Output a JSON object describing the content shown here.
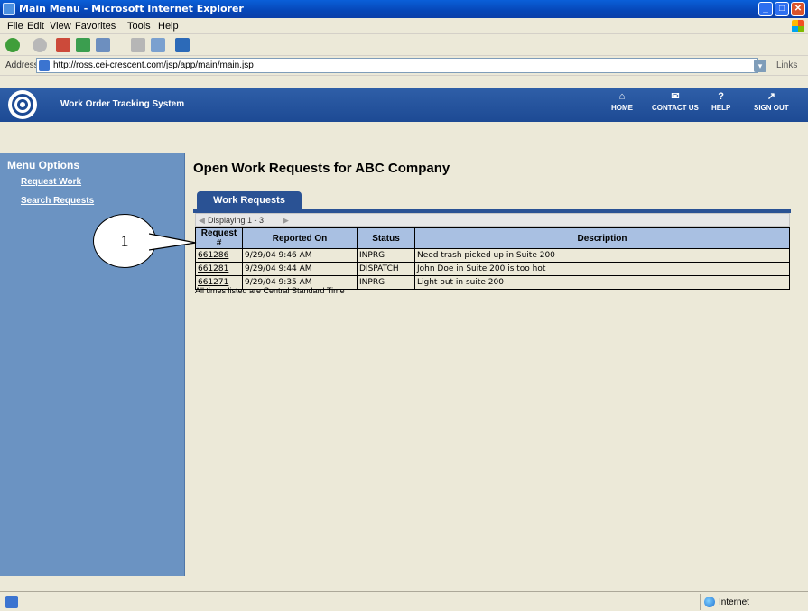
{
  "window": {
    "title": "Main Menu - Microsoft Internet Explorer"
  },
  "menubar": {
    "items": [
      "File",
      "Edit",
      "View",
      "Favorites",
      "Tools",
      "Help"
    ]
  },
  "address": {
    "label": "Address",
    "url": "http://ross.cei-crescent.com/jsp/app/main/main.jsp",
    "links_label": "Links"
  },
  "header": {
    "app_title": "Work Order Tracking System",
    "nav": {
      "home": "HOME",
      "contact": "CONTACT US",
      "help": "HELP",
      "signout": "SIGN OUT"
    }
  },
  "sidebar": {
    "heading": "Menu Options",
    "items": [
      "Request Work",
      "Search Requests"
    ]
  },
  "main": {
    "title": "Open Work Requests for ABC Company",
    "tab_label": "Work Requests",
    "paging": "Displaying 1 - 3",
    "columns": [
      "Request #",
      "Reported On",
      "Status",
      "Description"
    ],
    "rows": [
      {
        "request": "661286",
        "reported": "9/29/04 9:46 AM",
        "status": "INPRG",
        "description": "Need trash picked up in Suite 200"
      },
      {
        "request": "661281",
        "reported": "9/29/04 9:44 AM",
        "status": "DISPATCH",
        "description": "John Doe in Suite 200 is too hot"
      },
      {
        "request": "661271",
        "reported": "9/29/04 9:35 AM",
        "status": "INPRG",
        "description": "Light out in suite 200"
      }
    ],
    "note": "All times listed are Central Standard Time"
  },
  "callout": {
    "number": "1"
  },
  "status": {
    "zone": "Internet"
  },
  "colors": {
    "header_bg": "#1d4a94",
    "sidebar_bg": "#6b93c2",
    "table_header_bg": "#a9c0e2",
    "tab_bg": "#2a5294"
  }
}
